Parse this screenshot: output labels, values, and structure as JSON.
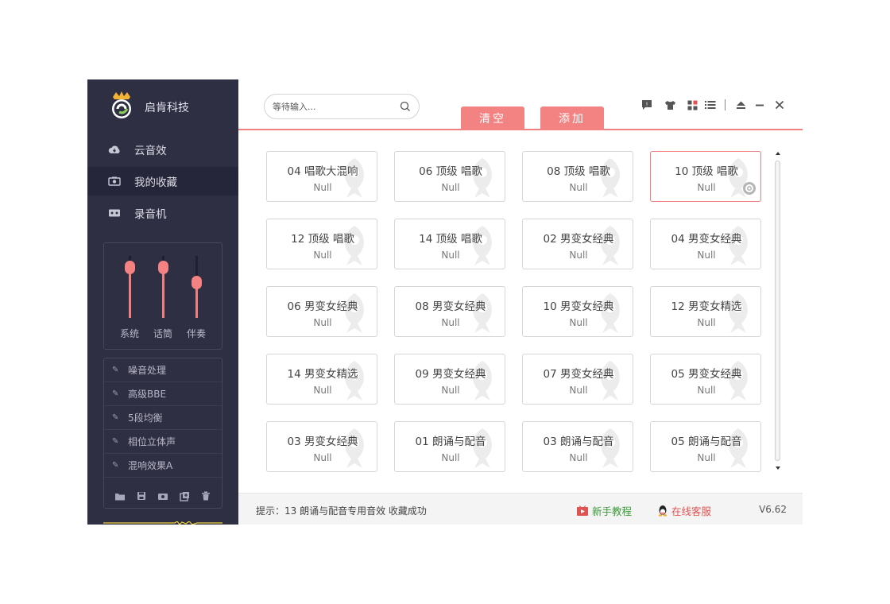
{
  "app": {
    "brand": "启肯科技",
    "version": "V6.62"
  },
  "sidebar": {
    "nav": [
      {
        "label": "云音效",
        "icon": "cloud-icon"
      },
      {
        "label": "我的收藏",
        "icon": "camera-icon"
      },
      {
        "label": "录音机",
        "icon": "recorder-icon"
      }
    ],
    "mixer": {
      "sliders": [
        {
          "label": "系统",
          "level": 0.9
        },
        {
          "label": "话筒",
          "level": 0.9
        },
        {
          "label": "伴奏",
          "level": 0.65
        }
      ]
    },
    "effects": [
      {
        "label": "噪音处理"
      },
      {
        "label": "高级BBE"
      },
      {
        "label": "5段均衡"
      },
      {
        "label": "相位立体声"
      },
      {
        "label": "混响效果A"
      }
    ],
    "tools": [
      "folder-icon",
      "save-icon",
      "camera-icon",
      "add-icon",
      "trash-icon"
    ]
  },
  "toolbar": {
    "search_placeholder": "等待输入...",
    "clear_label": "清空",
    "add_label": "添加"
  },
  "cards": [
    {
      "title": "04 唱歌大混响",
      "sub": "Null"
    },
    {
      "title": "06 顶级 唱歌",
      "sub": "Null"
    },
    {
      "title": "08 顶级 唱歌",
      "sub": "Null"
    },
    {
      "title": "10 顶级 唱歌",
      "sub": "Null",
      "selected": true
    },
    {
      "title": "12 顶级 唱歌",
      "sub": "Null"
    },
    {
      "title": "14 顶级 唱歌",
      "sub": "Null"
    },
    {
      "title": "02 男变女经典",
      "sub": "Null"
    },
    {
      "title": "04 男变女经典",
      "sub": "Null"
    },
    {
      "title": "06 男变女经典",
      "sub": "Null"
    },
    {
      "title": "08 男变女经典",
      "sub": "Null"
    },
    {
      "title": "10 男变女经典",
      "sub": "Null"
    },
    {
      "title": "12 男变女精选",
      "sub": "Null"
    },
    {
      "title": "14 男变女精选",
      "sub": "Null"
    },
    {
      "title": "09 男变女经典",
      "sub": "Null"
    },
    {
      "title": "07 男变女经典",
      "sub": "Null"
    },
    {
      "title": "05 男变女经典",
      "sub": "Null"
    },
    {
      "title": "03 男变女经典",
      "sub": "Null"
    },
    {
      "title": "01 朗诵与配音",
      "sub": "Null"
    },
    {
      "title": "03 朗诵与配音",
      "sub": "Null"
    },
    {
      "title": "05 朗诵与配音",
      "sub": "Null"
    }
  ],
  "footer": {
    "tip": "提示：13 朗诵与配音专用音效 收藏成功",
    "tutorial_label": "新手教程",
    "service_label": "在线客服"
  },
  "colors": {
    "accent": "#f38383",
    "sidebar_bg": "#2f2f44",
    "tutorial_green": "#3a9a3a",
    "service_red": "#e05353"
  }
}
